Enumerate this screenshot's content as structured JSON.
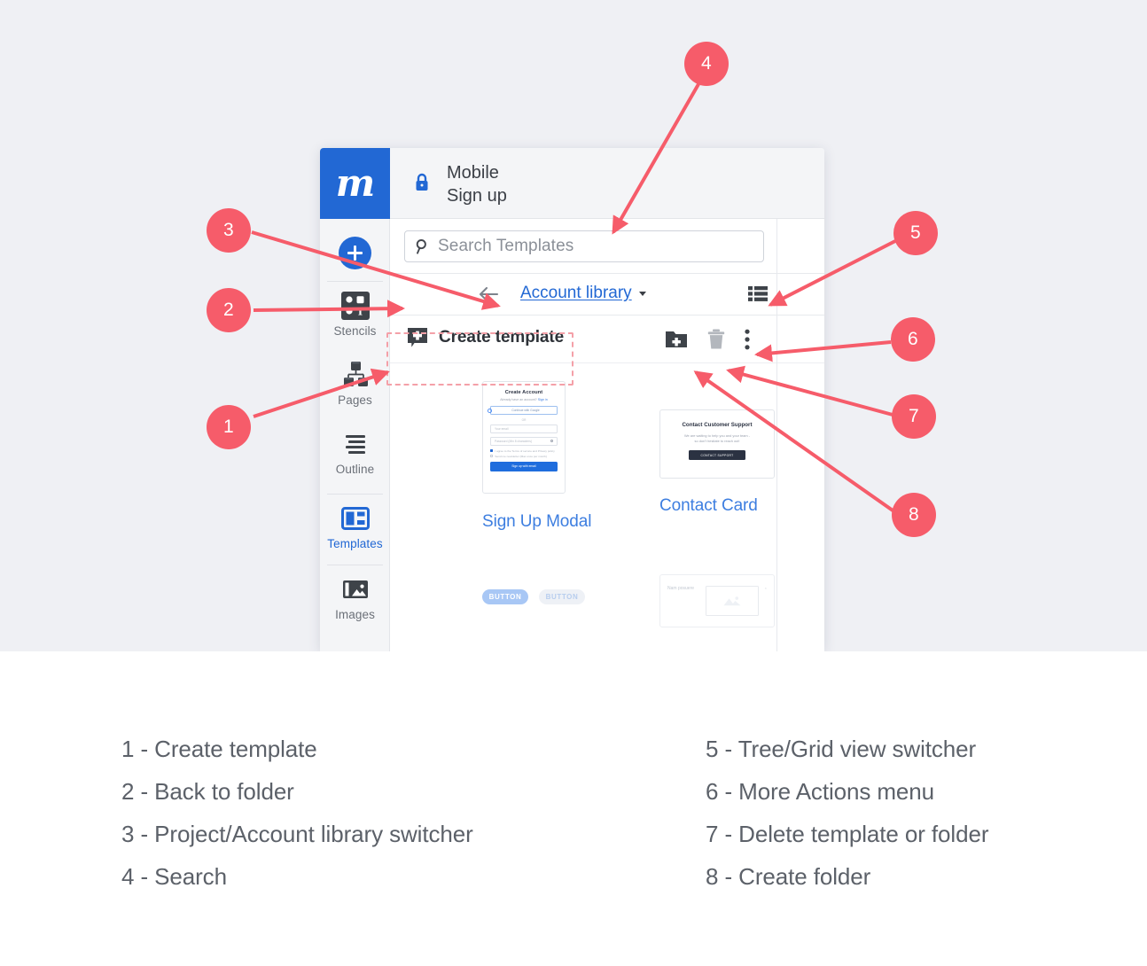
{
  "app": {
    "logo_letter": "m",
    "lock_icon": "lock-icon",
    "title_line1": "Mobile",
    "title_line2": "Sign up"
  },
  "sidebar": {
    "add_button_icon": "plus-circle-icon",
    "items": [
      {
        "label": "Stencils",
        "icon": "stencils-icon",
        "active": false
      },
      {
        "label": "Pages",
        "icon": "pages-icon",
        "active": false
      },
      {
        "label": "Outline",
        "icon": "outline-icon",
        "active": false
      },
      {
        "label": "Templates",
        "icon": "templates-icon",
        "active": true
      },
      {
        "label": "Images",
        "icon": "images-icon",
        "active": false
      }
    ]
  },
  "search": {
    "placeholder": "Search Templates",
    "icon": "search-icon"
  },
  "breadcrumb": {
    "back_icon": "arrow-left-icon",
    "library_label": "Account library",
    "caret_icon": "chevron-down-icon",
    "view_toggle_icon": "list-view-icon"
  },
  "actions": {
    "create_template_label": "Create template",
    "create_template_icon": "plus-square-icon",
    "create_folder_icon": "folder-plus-icon",
    "delete_icon": "trash-icon",
    "more_icon": "more-vertical-icon"
  },
  "gallery": {
    "cards": [
      {
        "title": "Sign Up Modal"
      },
      {
        "title": "Contact Card"
      }
    ],
    "signup_modal": {
      "heading": "Create Account",
      "sub_prefix": "Already have an account?",
      "sub_link": "Sign in",
      "google_button": "Continue with Google",
      "divider": "OR",
      "email_placeholder": "Your email",
      "password_placeholder": "Password (Min 8 characters)",
      "checkbox1": "I agree to the Terms of service and Privacy policy",
      "checkbox2": "Send me newsletter (Max once per month)",
      "submit": "Sign up with email"
    },
    "contact_card": {
      "heading": "Contact Customer Support",
      "body_line1": "We are waiting to help you and your team -",
      "body_line2": "so don't hesitate to reach out!",
      "button": "CONTACT SUPPORT"
    },
    "partial_row": {
      "pill1": "BUTTON",
      "pill2": "BUTTON",
      "card_text": "Nam posuere"
    }
  },
  "callouts": [
    {
      "number": "1"
    },
    {
      "number": "2"
    },
    {
      "number": "3"
    },
    {
      "number": "4"
    },
    {
      "number": "5"
    },
    {
      "number": "6"
    },
    {
      "number": "7"
    },
    {
      "number": "8"
    }
  ],
  "legend": {
    "left": [
      "1 - Create template",
      "2 - Back to folder",
      "3 - Project/Account library switcher",
      "4 - Search"
    ],
    "right": [
      "5 - Tree/Grid view switcher",
      "6 - More Actions menu",
      "7 - Delete template or folder",
      "8 - Create folder"
    ]
  },
  "colors": {
    "accent_red": "#f65c6a",
    "brand_blue": "#2268d4",
    "page_bg": "#eff0f4"
  }
}
